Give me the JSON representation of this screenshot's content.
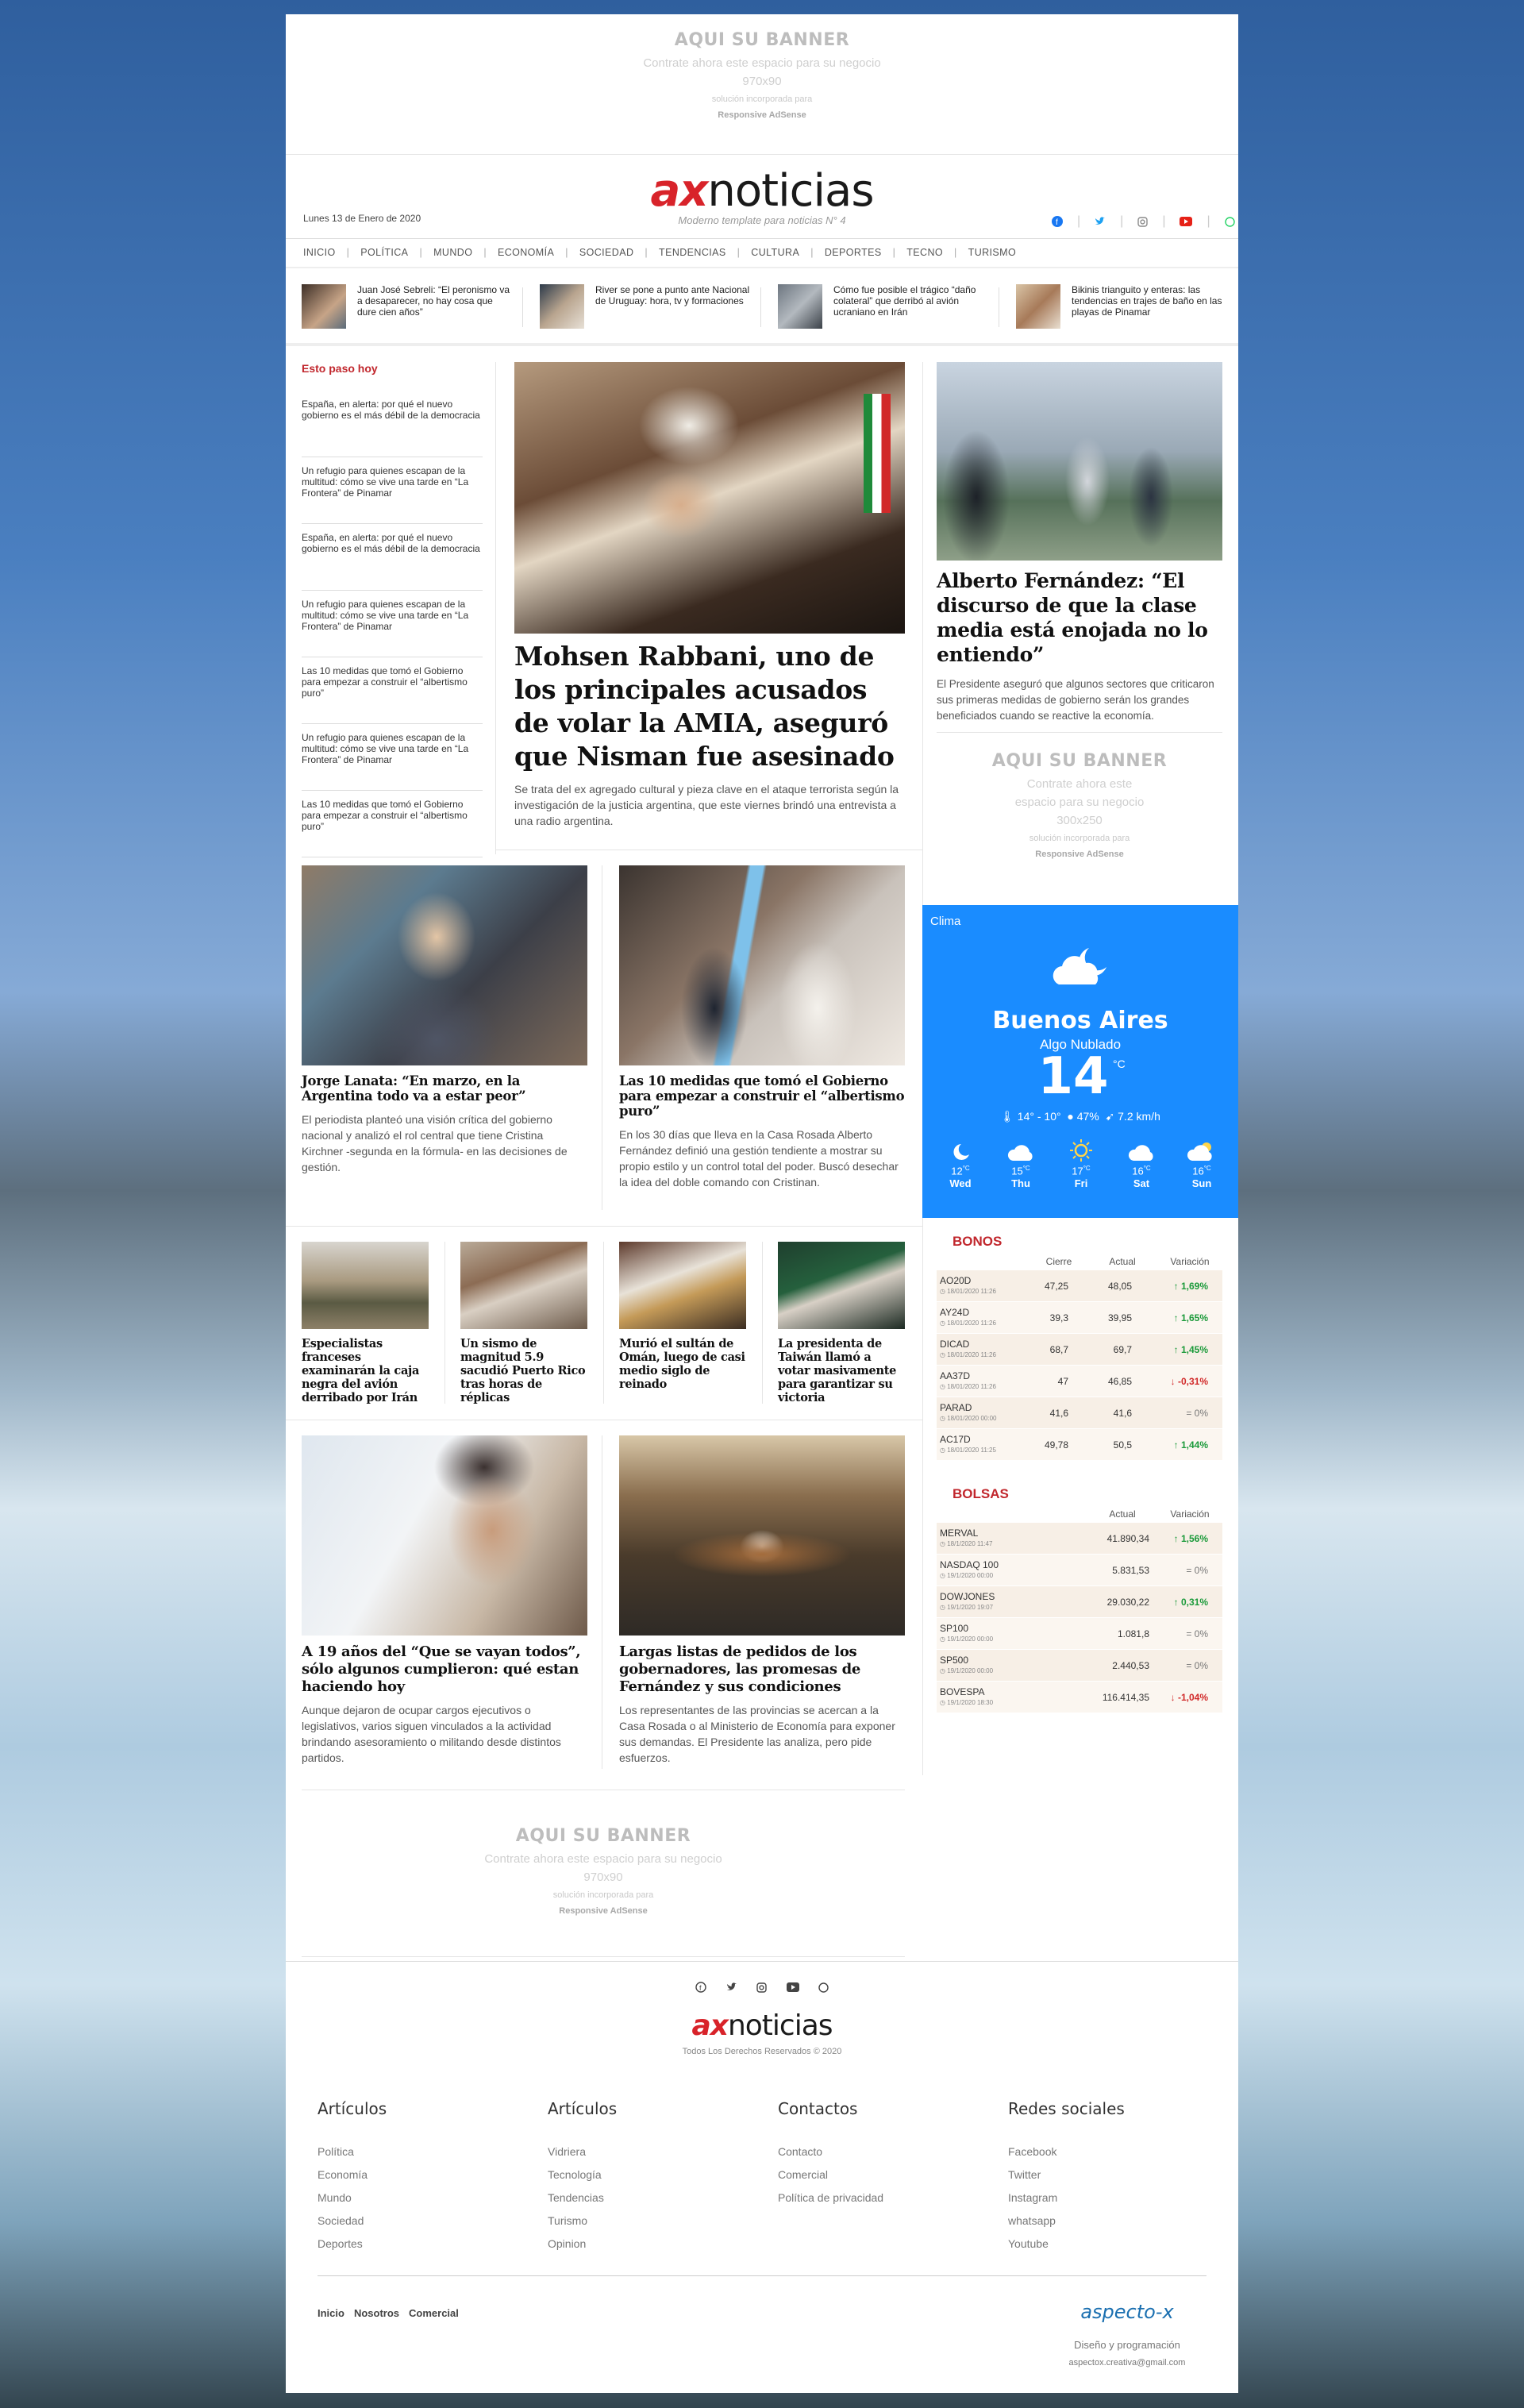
{
  "banner_top": {
    "title": "AQUI SU BANNER",
    "line1": "Contrate ahora este espacio para su negocio",
    "size": "970x90",
    "line2": "solución incorporada para",
    "line3": "Responsive AdSense"
  },
  "header": {
    "date": "Lunes 13 de Enero de 2020",
    "logo_ax": "ax",
    "logo_rest": "noticias",
    "tagline": "Moderno template para noticias N° 4"
  },
  "social_icons": [
    "facebook-icon",
    "twitter-icon",
    "instagram-icon",
    "youtube-icon",
    "whatsapp-icon"
  ],
  "colors": {
    "accent": "#d8232a",
    "weather_bg": "#1a8cff",
    "up": "#1b9a3a",
    "down": "#d12a2a"
  },
  "nav": [
    "INICIO",
    "POLÍTICA",
    "MUNDO",
    "ECONOMÍA",
    "SOCIEDAD",
    "TENDENCIAS",
    "CULTURA",
    "DEPORTES",
    "TECNO",
    "TURISMO"
  ],
  "ticker": [
    "Juan José Sebreli: “El peronismo va a desaparecer, no hay cosa que dure cien años”",
    "River se pone a punto ante Nacional de Uruguay: hora, tv y formaciones",
    "Cómo fue posible el trágico “daño colateral” que derribó al avión ucraniano en Irán",
    "Bikinis trianguito y enteras: las tendencias en trajes de baño en las playas de Pinamar"
  ],
  "sidebar_left": {
    "title": "Esto paso hoy",
    "items": [
      "España, en alerta: por qué el nuevo gobierno es el más débil de la democracia",
      "Un refugio para quienes escapan de la multitud: cómo se vive una tarde en “La Frontera” de Pinamar",
      "España, en alerta: por qué el nuevo gobierno es el más débil de la democracia",
      "Un refugio para quienes escapan de la multitud: cómo se vive una tarde en “La Frontera” de Pinamar",
      "Las 10 medidas que tomó el Gobierno para empezar a construir el “albertismo puro”",
      "Un refugio para quienes escapan de la multitud: cómo se vive una tarde en “La Frontera” de Pinamar",
      "Las 10 medidas que tomó el Gobierno para empezar a construir el “albertismo puro”"
    ]
  },
  "main_story": {
    "title": "Mohsen Rabbani, uno de los principales acusados de volar la AMIA, aseguró que Nisman fue asesinado",
    "text": "Se trata del ex agregado cultural y pieza clave en el ataque terrorista según la investigación de la justicia argentina, que este viernes brindó una entrevista a una radio argentina."
  },
  "right_story": {
    "title": "Alberto Fernández: “El discurso de que la clase media está enojada no lo entiendo”",
    "text": "El Presidente aseguró que algunos sectores que criticaron sus primeras medidas de gobierno serán los grandes beneficiados cuando se reactive la economía."
  },
  "banner_right": {
    "title": "AQUI SU BANNER",
    "line1a": "Contrate ahora este",
    "line1b": "espacio para su negocio",
    "size": "300x250",
    "line2": "solución incorporada para",
    "line3": "Responsive AdSense"
  },
  "pair1": [
    {
      "title": "Jorge Lanata: “En marzo, en la Argentina todo va a estar peor”",
      "text": "El periodista planteó una visión crítica del gobierno nacional y analizó el rol central que tiene Cristina Kirchner -segunda en la fórmula- en las decisiones de gestión."
    },
    {
      "title": "Las 10 medidas que tomó el Gobierno para empezar a construir el “albertismo puro”",
      "text": "En los 30 días que lleva en la Casa Rosada Alberto Fernández definió una gestión tendiente a mostrar su propio estilo y un control total del poder. Buscó desechar la idea del doble comando con Cristinan."
    }
  ],
  "quad": [
    "Especialistas franceses examinarán la caja negra del avión derribado por Irán",
    "Un sismo de magnitud 5.9 sacudió Puerto Rico tras horas de réplicas",
    "Murió el sultán de Omán, luego de casi medio siglo de reinado",
    "La presidenta de Taiwán llamó a votar masivamente para garantizar su victoria"
  ],
  "pair2": [
    {
      "title": "A 19 años del “Que se vayan todos”, sólo algunos cumplieron: qué estan haciendo hoy",
      "text": "Aunque dejaron de ocupar cargos ejecutivos o legislativos, varios siguen vinculados a la actividad brindando asesoramiento o militando desde distintos partidos."
    },
    {
      "title": "Largas listas de pedidos de los gobernadores, las promesas de Fernández y sus condiciones",
      "text": "Los representantes de las provincias se acercan a la Casa Rosada o al Ministerio de Economía para exponer sus demandas. El Presidente las analiza, pero pide esfuerzos."
    }
  ],
  "banner_bottom": {
    "title": "AQUI SU BANNER",
    "line1": "Contrate ahora este espacio para su negocio",
    "size": "970x90",
    "line2": "solución incorporada para",
    "line3": "Responsive AdSense"
  },
  "weather": {
    "label": "Clima",
    "city": "Buenos Aires",
    "condition": "Algo Nublado",
    "temp": "14",
    "unit": "°C",
    "range": "14° - 10°",
    "humidity": "47%",
    "wind": "7.2 km/h",
    "days": [
      {
        "t": "12",
        "d": "Wed",
        "icon": "moon-icon"
      },
      {
        "t": "15",
        "d": "Thu",
        "icon": "cloud-icon"
      },
      {
        "t": "17",
        "d": "Fri",
        "icon": "sun-icon"
      },
      {
        "t": "16",
        "d": "Sat",
        "icon": "cloud-icon"
      },
      {
        "t": "16",
        "d": "Sun",
        "icon": "cloud-sun-icon"
      }
    ]
  },
  "bonos": {
    "title": "BONOS",
    "headers": [
      "Cierre",
      "Actual",
      "Variación"
    ],
    "rows": [
      {
        "n": "AO20D",
        "ts": "18/01/2020 11:26",
        "c": "47,25",
        "a": "48,05",
        "v": "1,69%",
        "dir": "up"
      },
      {
        "n": "AY24D",
        "ts": "18/01/2020 11:26",
        "c": "39,3",
        "a": "39,95",
        "v": "1,65%",
        "dir": "up"
      },
      {
        "n": "DICAD",
        "ts": "18/01/2020 11:26",
        "c": "68,7",
        "a": "69,7",
        "v": "1,45%",
        "dir": "up"
      },
      {
        "n": "AA37D",
        "ts": "18/01/2020 11:26",
        "c": "47",
        "a": "46,85",
        "v": "-0,31%",
        "dir": "down"
      },
      {
        "n": "PARAD",
        "ts": "18/01/2020 00:00",
        "c": "41,6",
        "a": "41,6",
        "v": "0%",
        "dir": "zero"
      },
      {
        "n": "AC17D",
        "ts": "18/01/2020 11:25",
        "c": "49,78",
        "a": "50,5",
        "v": "1,44%",
        "dir": "up"
      }
    ]
  },
  "bolsas": {
    "title": "BOLSAS",
    "headers": [
      "Actual",
      "Variación"
    ],
    "rows": [
      {
        "n": "MERVAL",
        "ts": "18/1/2020 11:47",
        "a": "41.890,34",
        "v": "1,56%",
        "dir": "up"
      },
      {
        "n": "NASDAQ 100",
        "ts": "19/1/2020 00:00",
        "a": "5.831,53",
        "v": "0%",
        "dir": "zero"
      },
      {
        "n": "DOWJONES",
        "ts": "19/1/2020 19:07",
        "a": "29.030,22",
        "v": "0,31%",
        "dir": "up"
      },
      {
        "n": "SP100",
        "ts": "19/1/2020 00:00",
        "a": "1.081,8",
        "v": "0%",
        "dir": "zero"
      },
      {
        "n": "SP500",
        "ts": "19/1/2020 00:00",
        "a": "2.440,53",
        "v": "0%",
        "dir": "zero"
      },
      {
        "n": "BOVESPA",
        "ts": "19/1/2020 18:30",
        "a": "116.414,35",
        "v": "-1,04%",
        "dir": "down"
      }
    ]
  },
  "footer": {
    "logo_ax": "ax",
    "logo_rest": "noticias",
    "rights": "Todos Los Derechos Reservados © 2020",
    "cols": [
      {
        "h": "Artículos",
        "links": [
          "Política",
          "Economía",
          "Mundo",
          "Sociedad",
          "Deportes"
        ]
      },
      {
        "h": "Artículos",
        "links": [
          "Vidriera",
          "Tecnología",
          "Tendencias",
          "Turismo",
          "Opinion"
        ]
      },
      {
        "h": "Contactos",
        "links": [
          "Contacto",
          "Comercial",
          "Política de privacidad"
        ]
      },
      {
        "h": "Redes sociales",
        "links": [
          "Facebook",
          "Twitter",
          "Instagram",
          "whatsapp",
          "Youtube"
        ]
      }
    ],
    "bottom_links": [
      "Inicio",
      "Nosotros",
      "Comercial"
    ],
    "brand": "aspecto-x",
    "credit": "Diseño y programación",
    "email": "aspectox.creativa@gmail.com"
  }
}
